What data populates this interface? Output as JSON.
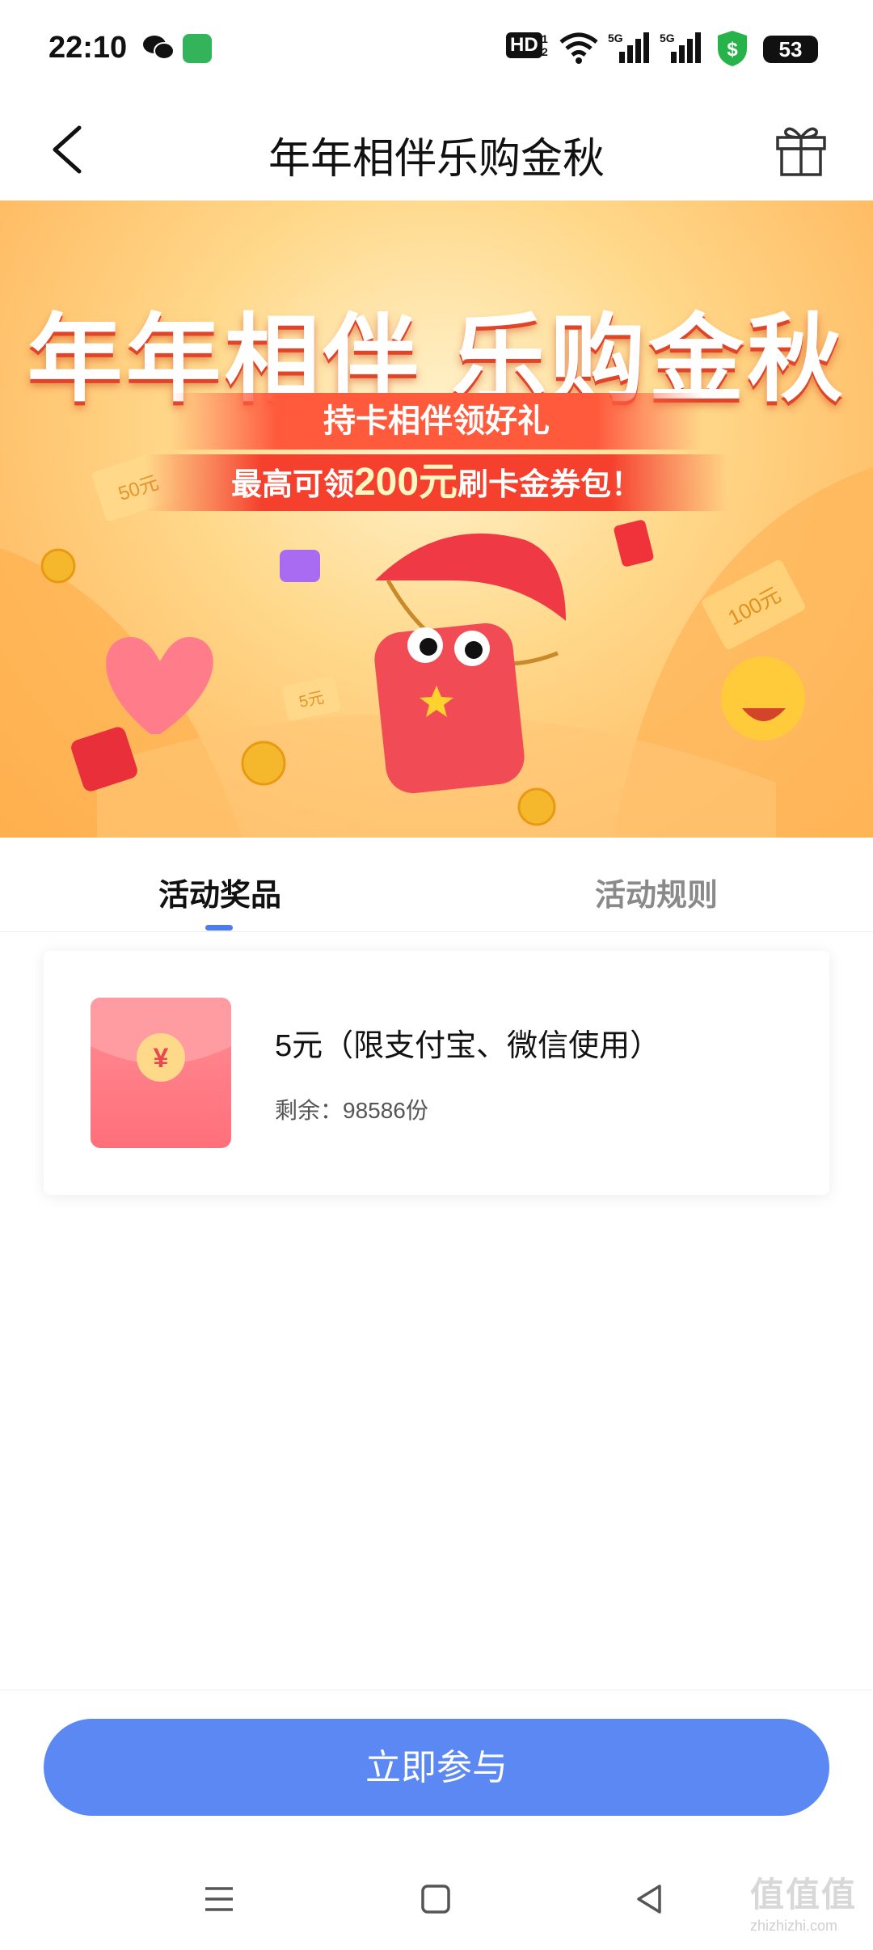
{
  "status_bar": {
    "time": "22:10",
    "hd_label": "HD",
    "hd_sub": "1 2",
    "network_1": "5G",
    "network_2": "5G",
    "battery": "53",
    "icons": [
      "wechat-icon",
      "message-icon",
      "wifi-icon",
      "signal-icon",
      "signal-icon",
      "shield-icon",
      "battery-icon"
    ]
  },
  "header": {
    "title": "年年相伴乐购金秋",
    "back_icon": "chevron-left-icon",
    "gift_icon": "gift-icon"
  },
  "banner": {
    "title": "年年相伴 乐购金秋",
    "subtitle": "持卡相伴领好礼",
    "promo_prefix": "最高可领",
    "promo_amount": "200元",
    "promo_suffix": "刷卡金券包！",
    "ticket_labels": [
      "50元",
      "100元",
      "5元"
    ]
  },
  "tabs": [
    {
      "label": "活动奖品",
      "active": true
    },
    {
      "label": "活动规则",
      "active": false
    }
  ],
  "prizes": [
    {
      "name": "5元（限支付宝、微信使用）",
      "remaining": "剩余：98586份",
      "icon_symbol": "¥"
    }
  ],
  "action": {
    "join_label": "立即参与"
  },
  "watermark": {
    "text": "值值值",
    "sub": "zhizhizhi.com"
  },
  "colors": {
    "accent_blue": "#5b88f2",
    "tab_indicator": "#4d7cf0",
    "envelope_pink": "#ff7a84"
  }
}
